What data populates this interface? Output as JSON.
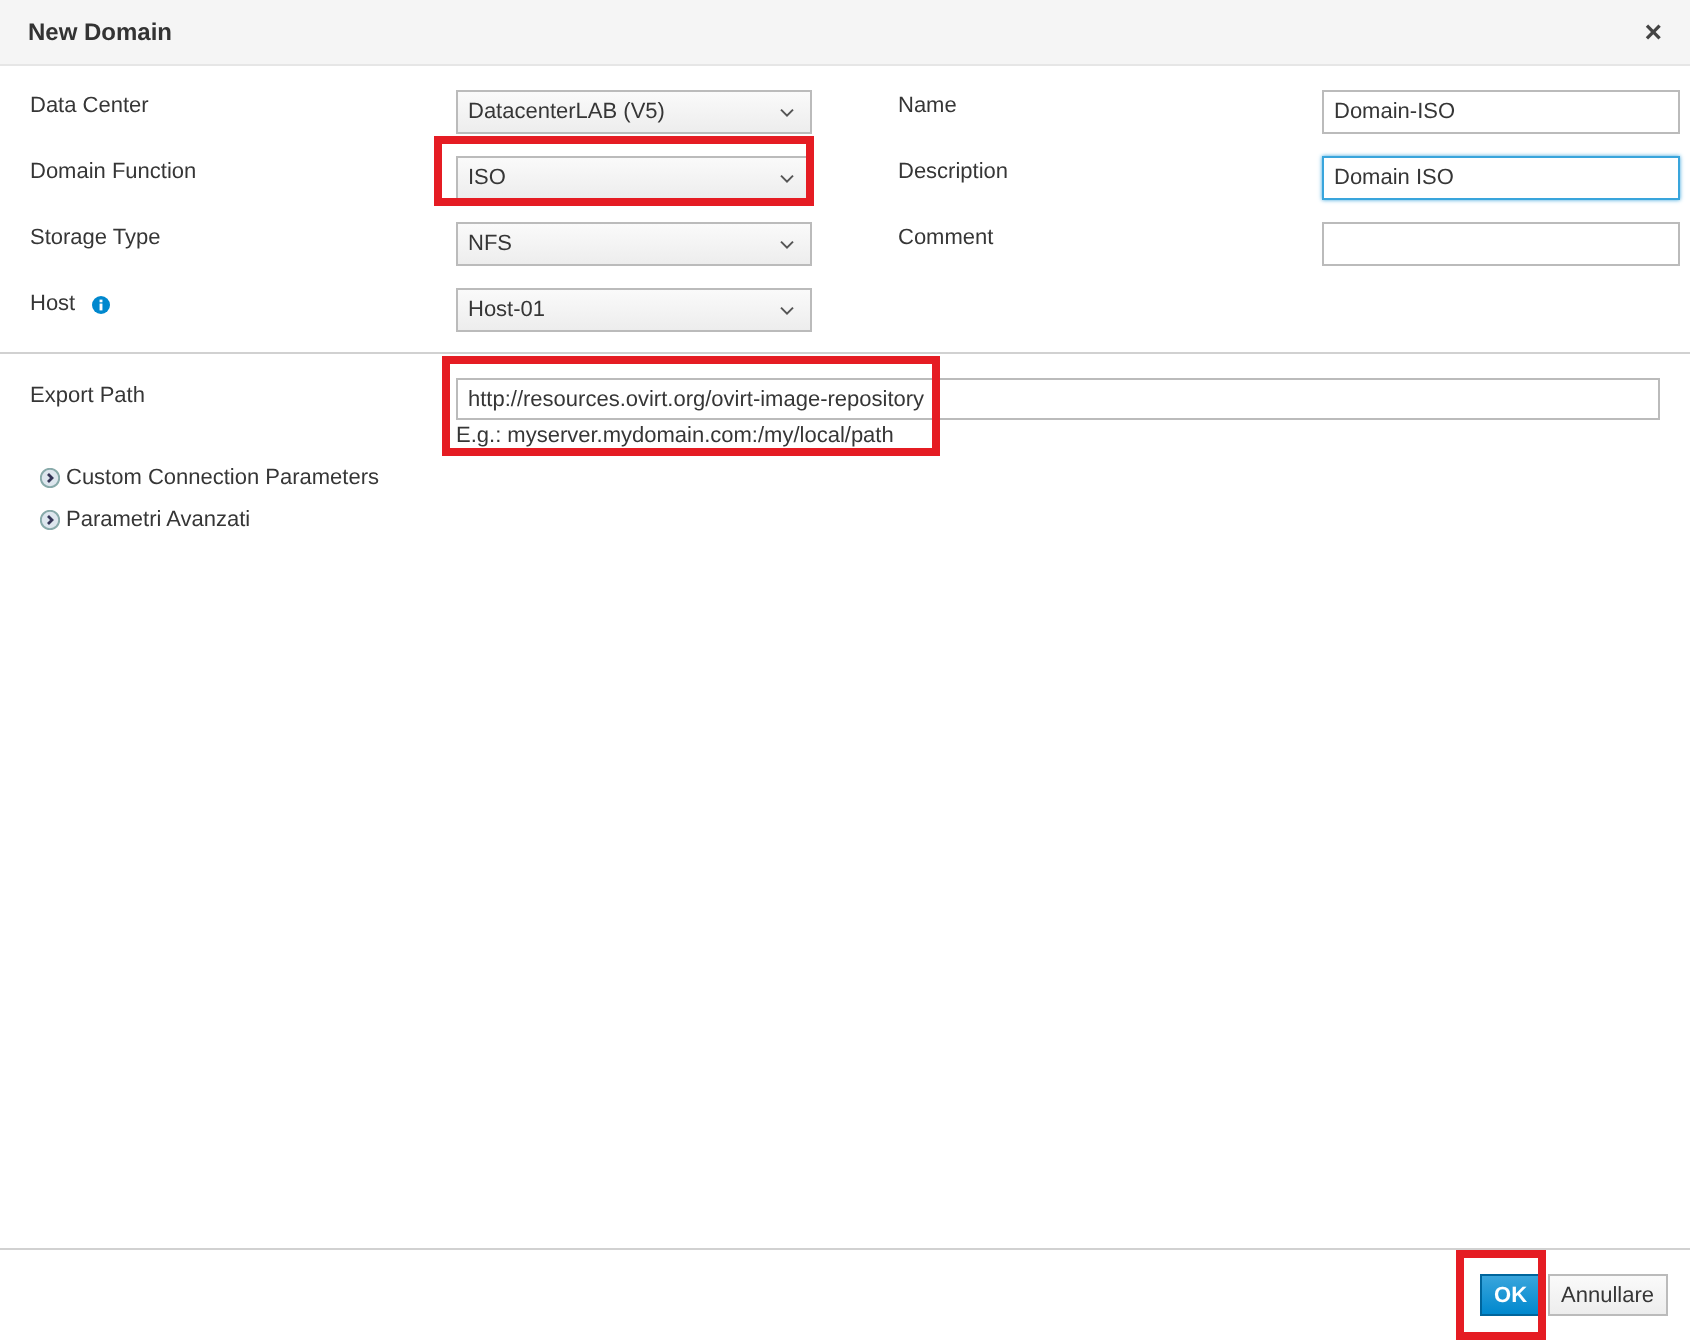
{
  "dialog": {
    "title": "New Domain",
    "close": "×"
  },
  "left_fields": [
    {
      "label": "Data Center",
      "value": "DatacenterLAB (V5)",
      "info": false,
      "highlighted": false
    },
    {
      "label": "Domain Function",
      "value": "ISO",
      "info": false,
      "highlighted": true
    },
    {
      "label": "Storage Type",
      "value": "NFS",
      "info": false,
      "highlighted": false
    },
    {
      "label": "Host",
      "value": "Host-01",
      "info": true,
      "highlighted": false
    }
  ],
  "right_fields": [
    {
      "label": "Name",
      "value": "Domain-ISO",
      "focused": false
    },
    {
      "label": "Description",
      "value": "Domain ISO",
      "focused": true
    },
    {
      "label": "Comment",
      "focused": false
    }
  ],
  "export_path": {
    "label": "Export Path",
    "value": "http://resources.ovirt.org/ovirt-image-repository",
    "hint": "E.g.: myserver.mydomain.com:/my/local/path",
    "highlighted": true
  },
  "sections": [
    {
      "label": "Custom Connection Parameters",
      "expanded": false
    },
    {
      "label": "Parametri Avanzati",
      "expanded": false
    }
  ],
  "buttons": [
    {
      "label": "OK",
      "kind": "primary",
      "highlighted": true
    },
    {
      "label": "Annullare",
      "kind": "secondary",
      "highlighted": false
    }
  ]
}
